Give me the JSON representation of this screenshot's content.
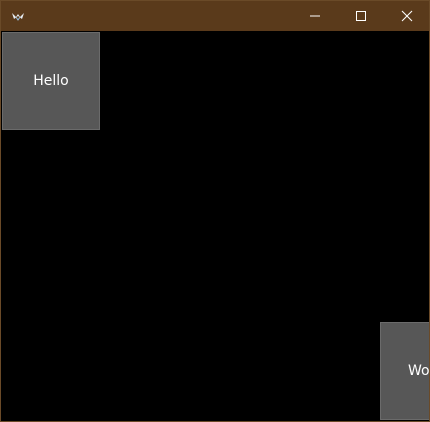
{
  "titlebar": {
    "icon": "kivy-logo-icon",
    "controls": {
      "minimize": "minimize-icon",
      "maximize": "maximize-icon",
      "close": "close-icon"
    },
    "color": "#5a3a1b"
  },
  "content": {
    "background": "#000000",
    "buttons": [
      {
        "label": "Hello"
      },
      {
        "label": "Wo"
      }
    ]
  },
  "colors": {
    "button_bg": "#575757",
    "button_text": "#ffffff"
  }
}
